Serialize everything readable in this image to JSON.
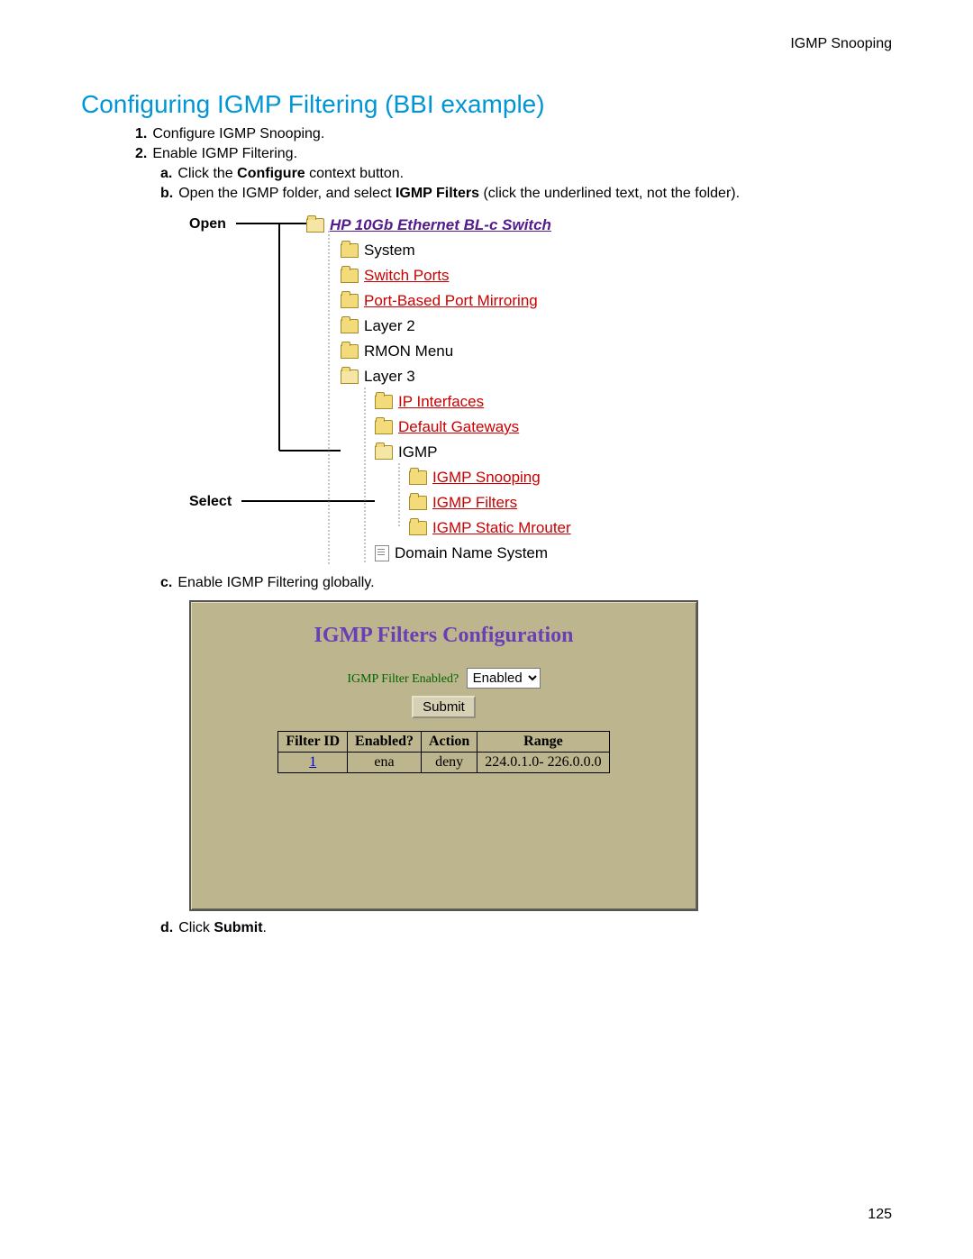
{
  "header_right": "IGMP Snooping",
  "section_title": "Configuring IGMP Filtering (BBI example)",
  "steps": {
    "s1_num": "1.",
    "s1_text": "Configure IGMP Snooping.",
    "s2_num": "2.",
    "s2_text": "Enable IGMP Filtering.",
    "a_alpha": "a.",
    "a_pre": "Click the ",
    "a_bold": "Configure",
    "a_post": " context button.",
    "b_alpha": "b.",
    "b_pre": "Open the IGMP folder, and select ",
    "b_bold": "IGMP Filters",
    "b_post": " (click the underlined text, not the folder).",
    "c_alpha": "c.",
    "c_text": "Enable IGMP Filtering globally.",
    "d_alpha": "d.",
    "d_pre": "Click ",
    "d_bold": "Submit",
    "d_post": "."
  },
  "callouts": {
    "open": "Open",
    "select": "Select"
  },
  "tree": {
    "root": "HP 10Gb Ethernet BL-c Switch",
    "system": "System",
    "switch_ports": "Switch Ports",
    "port_mirror": "Port-Based Port Mirroring",
    "layer2": "Layer 2",
    "rmon": "RMON Menu",
    "layer3": "Layer 3",
    "ip_if": "IP Interfaces",
    "gateways": "Default Gateways",
    "igmp": "IGMP",
    "igmp_snoop": "IGMP Snooping",
    "igmp_filters": "IGMP Filters",
    "igmp_mrouter": "IGMP Static Mrouter",
    "dns": "Domain Name System"
  },
  "panel": {
    "title": "IGMP Filters Configuration",
    "enabled_label": "IGMP Filter Enabled?",
    "enabled_value": "Enabled",
    "submit": "Submit",
    "headers": {
      "fid": "Filter ID",
      "en": "Enabled?",
      "act": "Action",
      "range": "Range"
    },
    "row": {
      "fid": "1",
      "en": "ena",
      "act": "deny",
      "range": "224.0.1.0- 226.0.0.0"
    }
  },
  "page_number": "125"
}
